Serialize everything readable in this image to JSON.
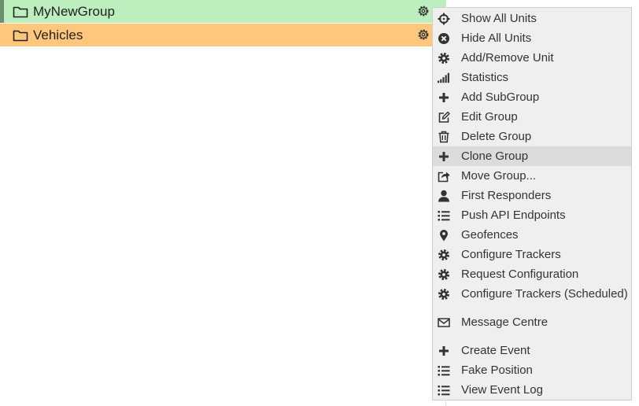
{
  "groups": [
    {
      "name": "MyNewGroup",
      "color": "#bdeebe",
      "accent": "#6d8f6e"
    },
    {
      "name": "Vehicles",
      "color": "#fec77c",
      "accent": "#fec77c"
    }
  ],
  "menu": {
    "items": [
      {
        "label": "Show All Units",
        "icon": "crosshairs-icon"
      },
      {
        "label": "Hide All Units",
        "icon": "times-circle-icon"
      },
      {
        "label": "Add/Remove Unit",
        "icon": "gear-icon"
      },
      {
        "label": "Statistics",
        "icon": "signal-bars-icon"
      },
      {
        "label": "Add SubGroup",
        "icon": "plus-icon"
      },
      {
        "label": "Edit Group",
        "icon": "edit-icon"
      },
      {
        "label": "Delete Group",
        "icon": "trash-icon"
      },
      {
        "label": "Clone Group",
        "icon": "plus-icon",
        "highlighted": true
      },
      {
        "label": "Move Group...",
        "icon": "share-icon"
      },
      {
        "label": "First Responders",
        "icon": "user-icon"
      },
      {
        "label": "Push API Endpoints",
        "icon": "list-icon"
      },
      {
        "label": "Geofences",
        "icon": "map-marker-icon"
      },
      {
        "label": "Configure Trackers",
        "icon": "gear-icon"
      },
      {
        "label": "Request Configuration",
        "icon": "gear-icon"
      },
      {
        "label": "Configure Trackers (Scheduled)",
        "icon": "gear-icon"
      },
      {
        "label": "Message Centre",
        "icon": "envelope-icon"
      },
      {
        "label": "Create Event",
        "icon": "plus-icon"
      },
      {
        "label": "Fake Position",
        "icon": "list-icon"
      },
      {
        "label": "View Event Log",
        "icon": "list-icon"
      }
    ],
    "highlight_color": "#dcdcdc"
  }
}
